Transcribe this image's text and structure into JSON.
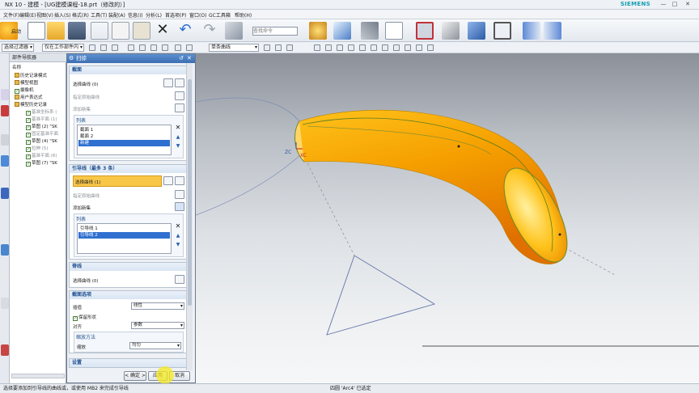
{
  "window": {
    "title": "NX 10 - 建模 - [UG建模课程-18.prt（修改的）]",
    "brand": "SIEMENS"
  },
  "menu": [
    "文件(F)",
    "编辑(E)",
    "视图(V)",
    "插入(S)",
    "格式(R)",
    "工具(T)",
    "装配(A)",
    "信息(I)",
    "分析(L)",
    "首选项(P)",
    "窗口(O)",
    "GC工具箱",
    "帮助(H)"
  ],
  "ribbon": {
    "start_label": "启动",
    "command_search_placeholder": "查找命令"
  },
  "filterbar": {
    "selection_filter": "选择过滤器",
    "scope": "仅在工作部件内",
    "curve_rule": "单条曲线"
  },
  "navigator": {
    "title": "部件导航器",
    "column_name": "名称",
    "items": [
      {
        "label": "历史记录模式",
        "indent": 1,
        "checked": false,
        "dim": false
      },
      {
        "label": "模型视图",
        "indent": 1,
        "checked": false,
        "dim": false
      },
      {
        "label": "摄像机",
        "indent": 1,
        "checked": true,
        "dim": false
      },
      {
        "label": "用户表达式",
        "indent": 1,
        "checked": false,
        "dim": false
      },
      {
        "label": "模型历史记录",
        "indent": 1,
        "checked": false,
        "dim": false
      },
      {
        "label": "基准坐标系 (",
        "indent": 2,
        "checked": true,
        "dim": true
      },
      {
        "label": "基准平面 (1)",
        "indent": 2,
        "checked": true,
        "dim": true
      },
      {
        "label": "草图 (2) \"SK",
        "indent": 2,
        "checked": true,
        "dim": false
      },
      {
        "label": "固定基准平面",
        "indent": 2,
        "checked": true,
        "dim": true
      },
      {
        "label": "草图 (4) \"SK",
        "indent": 2,
        "checked": true,
        "dim": false
      },
      {
        "label": "拉伸 (5)",
        "indent": 2,
        "checked": true,
        "dim": true
      },
      {
        "label": "基准平面 (6)",
        "indent": 2,
        "checked": true,
        "dim": true
      },
      {
        "label": "草图 (7) \"SK",
        "indent": 2,
        "checked": true,
        "dim": false
      }
    ]
  },
  "dialog": {
    "title": "扫掠",
    "section": {
      "header": "截面",
      "select_curve": "选择曲线 (0)",
      "specify_origin": "指定原始曲线",
      "add_new": "添加新集",
      "list_header": "列表",
      "list": [
        "截面 1",
        "截面 2",
        "新建"
      ]
    },
    "guide": {
      "header": "引导线（最多 3 条）",
      "select_curve": "选择曲线 (1)",
      "specify_origin": "指定原始曲线",
      "add_new": "添加新集",
      "list_header": "列表",
      "list": [
        "引导线 1",
        "引导线 2"
      ]
    },
    "spine": {
      "header": "脊线",
      "select_curve": "选择曲线 (0)"
    },
    "section_options": {
      "header": "截面选项",
      "interpolation_label": "插值",
      "interpolation_value": "线性",
      "preserve_shape": "保留形状",
      "alignment_label": "对齐",
      "alignment_value": "参数",
      "scaling_header": "缩放方法",
      "scaling_label": "缩放",
      "scaling_value": "均匀"
    },
    "settings_header": "设置",
    "buttons": {
      "ok": "< 确定 >",
      "apply": "应用",
      "cancel": "取消"
    }
  },
  "viewport": {
    "triad_z": "ZC",
    "triad_x": "XC"
  },
  "status": {
    "left": "选择要添加到引导线的曲线或，或使用 MB2 来完成引导线",
    "right": "四圆 'Arc4' 已选定"
  },
  "colors": {
    "sweep_body": "#f5a000",
    "selected_row": "#2f6fd0",
    "selected_field": "#f8c748"
  }
}
